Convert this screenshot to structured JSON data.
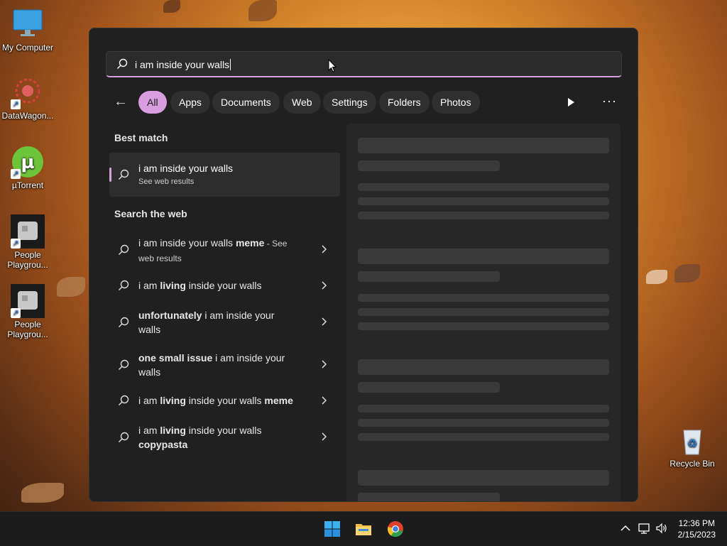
{
  "desktop": {
    "icons": [
      {
        "label": "My Computer",
        "icon": "monitor-icon"
      },
      {
        "label": "DataWagon...",
        "icon": "datawagon-icon"
      },
      {
        "label": "µTorrent",
        "icon": "utorrent-icon"
      },
      {
        "label": "People Playgrou...",
        "icon": "people-playground-icon"
      },
      {
        "label": "People Playgrou...",
        "icon": "people-playground-icon"
      },
      {
        "label": "Recycle Bin",
        "icon": "recycle-bin-icon"
      }
    ]
  },
  "search": {
    "query": "i am inside your walls",
    "filters": [
      "All",
      "Apps",
      "Documents",
      "Web",
      "Settings",
      "Folders",
      "Photos"
    ],
    "active_filter": "All",
    "more_label": "···"
  },
  "results": {
    "best_match_title": "Best match",
    "best_match": {
      "title": "i am inside your walls",
      "subtitle": "See web results"
    },
    "search_web_title": "Search the web",
    "web": [
      {
        "line1": "i am inside your walls ",
        "bold1": "meme",
        "rest1": " - See",
        "line2": "web results"
      },
      {
        "pre": "i am ",
        "bold": "living",
        "post": " inside your walls"
      },
      {
        "bold": "unfortunately",
        "post": " i am inside your",
        "line2": "walls"
      },
      {
        "bold": "one small issue",
        "post": " i am inside your",
        "line2": "walls"
      },
      {
        "pre": "i am ",
        "bold": "living",
        "post": " inside your walls ",
        "bold2": "meme"
      },
      {
        "pre": "i am ",
        "bold": "living",
        "post": " inside your walls",
        "line2bold": "copypasta"
      }
    ]
  },
  "taskbar": {
    "time": "12:36 PM",
    "date": "2/15/2023",
    "apps": [
      "windows-start-icon",
      "file-explorer-icon",
      "chrome-icon"
    ]
  },
  "colors": {
    "accent": "#d99ee0",
    "panel": "#202020"
  }
}
